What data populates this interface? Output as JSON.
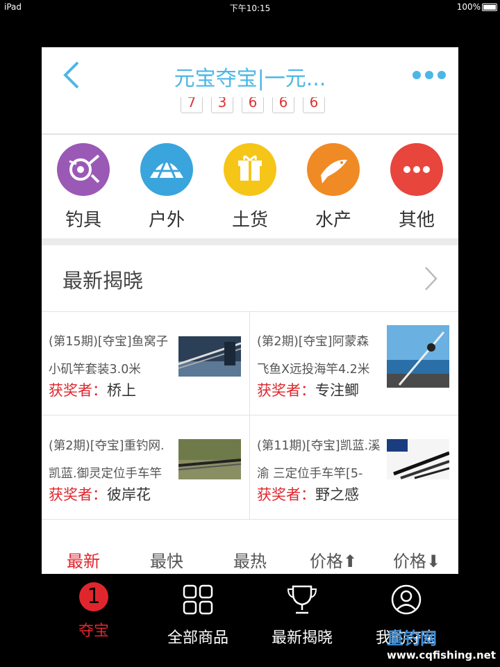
{
  "status_bar": {
    "device": "iPad",
    "time": "下午10:15",
    "battery": "100%"
  },
  "navbar": {
    "title": "元宝夺宝|一元...",
    "back_icon": "chevron-left-icon",
    "more_icon": "more-dots-icon",
    "accent": "#4cb7e6"
  },
  "counter": {
    "digits": [
      "7",
      "3",
      "6",
      "6",
      "6"
    ]
  },
  "categories": [
    {
      "label": "钓具",
      "icon": "fishing-reel-icon",
      "color": "#9b59b6"
    },
    {
      "label": "户外",
      "icon": "tent-icon",
      "color": "#3aa5dc"
    },
    {
      "label": "土货",
      "icon": "gift-icon",
      "color": "#f5c518"
    },
    {
      "label": "水产",
      "icon": "fish-icon",
      "color": "#f08a24"
    },
    {
      "label": "其他",
      "icon": "more-icon",
      "color": "#e8453c"
    }
  ],
  "latest": {
    "title": "最新揭晓",
    "items": [
      {
        "line1": "(第15期)[夺宝]鱼窝子",
        "line2": "小矶竿套装3.0米",
        "winner_label": "获奖者：",
        "winner": "桥上"
      },
      {
        "line1": "(第2期)[夺宝]阿蒙森",
        "line2": "飞鱼X远投海竿4.2米",
        "winner_label": "获奖者：",
        "winner": "专注鲫"
      },
      {
        "line1": "(第2期)[夺宝]重钓网.",
        "line2": "凯蓝.御灵定位手车竿",
        "winner_label": "获奖者：",
        "winner": "彼岸花"
      },
      {
        "line1": "(第11期)[夺宝]凯蓝.溪",
        "line2": "渝 三定位手车竿[5-",
        "winner_label": "获奖者：",
        "winner": "野之感"
      }
    ]
  },
  "sort_tabs": [
    "最新",
    "最快",
    "最热",
    "价格",
    "价格"
  ],
  "tabbar": [
    {
      "label": "夺宝",
      "badge": "1"
    },
    {
      "label": "全部商品",
      "icon": "grid-icon"
    },
    {
      "label": "最新揭晓",
      "icon": "trophy-icon"
    },
    {
      "label": "我的夺宝",
      "icon": "user-icon"
    }
  ],
  "watermark": {
    "brand": "重钓网",
    "url": "www.cqfishing.net"
  }
}
